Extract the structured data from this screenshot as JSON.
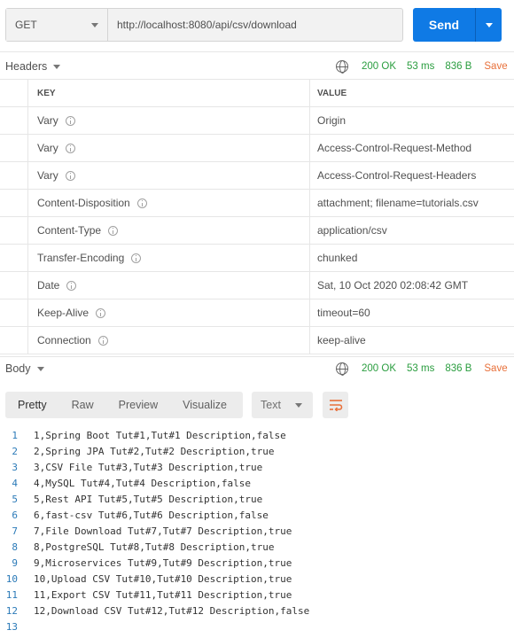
{
  "request": {
    "method": "GET",
    "url": "http://localhost:8080/api/csv/download",
    "send_label": "Send"
  },
  "response_meta": {
    "status": "200 OK",
    "time": "53 ms",
    "size": "836 B",
    "save_label": "Save"
  },
  "headers_section": {
    "title": "Headers",
    "column_key": "KEY",
    "column_value": "VALUE",
    "rows": [
      {
        "key": "Vary",
        "value": "Origin"
      },
      {
        "key": "Vary",
        "value": "Access-Control-Request-Method"
      },
      {
        "key": "Vary",
        "value": "Access-Control-Request-Headers"
      },
      {
        "key": "Content-Disposition",
        "value": "attachment; filename=tutorials.csv"
      },
      {
        "key": "Content-Type",
        "value": "application/csv"
      },
      {
        "key": "Transfer-Encoding",
        "value": "chunked"
      },
      {
        "key": "Date",
        "value": "Sat, 10 Oct 2020 02:08:42 GMT"
      },
      {
        "key": "Keep-Alive",
        "value": "timeout=60"
      },
      {
        "key": "Connection",
        "value": "keep-alive"
      }
    ]
  },
  "body_section": {
    "title": "Body",
    "view_tabs": [
      "Pretty",
      "Raw",
      "Preview",
      "Visualize"
    ],
    "active_tab": "Pretty",
    "format": "Text",
    "lines": [
      {
        "n": "1",
        "text": "1,Spring Boot Tut#1,Tut#1 Description,false"
      },
      {
        "n": "2",
        "text": "2,Spring JPA Tut#2,Tut#2 Description,true"
      },
      {
        "n": "3",
        "text": "3,CSV File Tut#3,Tut#3 Description,true"
      },
      {
        "n": "4",
        "text": "4,MySQL Tut#4,Tut#4 Description,false"
      },
      {
        "n": "5",
        "text": "5,Rest API Tut#5,Tut#5 Description,true"
      },
      {
        "n": "6",
        "text": "6,fast-csv Tut#6,Tut#6 Description,false"
      },
      {
        "n": "7",
        "text": "7,File Download Tut#7,Tut#7 Description,true"
      },
      {
        "n": "8",
        "text": "8,PostgreSQL Tut#8,Tut#8 Description,true"
      },
      {
        "n": "9",
        "text": "9,Microservices Tut#9,Tut#9 Description,true"
      },
      {
        "n": "10",
        "text": "10,Upload CSV Tut#10,Tut#10 Description,true"
      },
      {
        "n": "11",
        "text": "11,Export CSV Tut#11,Tut#11 Description,true"
      },
      {
        "n": "12",
        "text": "12,Download CSV Tut#12,Tut#12 Description,false"
      },
      {
        "n": "13",
        "text": ""
      }
    ]
  },
  "colors": {
    "send_button": "#0f7ae5",
    "status_ok": "#2a9d3f",
    "save_link": "#e8703a",
    "line_number": "#2b7ab8"
  }
}
